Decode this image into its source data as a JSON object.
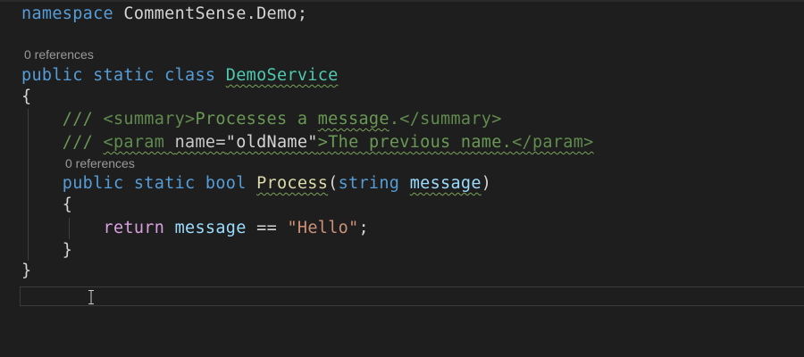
{
  "editor": {
    "lines": [
      {
        "tokens": [
          {
            "t": "namespace",
            "c": "kw"
          },
          {
            "t": " CommentSense.Demo;",
            "c": "plain"
          }
        ]
      },
      {
        "tokens": []
      },
      {
        "tokens": [
          {
            "t": "public static class ",
            "c": "kw"
          },
          {
            "t": "DemoService",
            "c": "cls",
            "sq": true
          }
        ]
      },
      {
        "tokens": [
          {
            "t": "{",
            "c": "plain"
          }
        ]
      },
      {
        "tokens": [
          {
            "t": "    /// ",
            "c": "cm"
          },
          {
            "t": "<summary>",
            "c": "tag"
          },
          {
            "t": "Processes a ",
            "c": "cm"
          },
          {
            "t": "message",
            "c": "cm",
            "sq": true
          },
          {
            "t": ".",
            "c": "cm"
          },
          {
            "t": "</summary>",
            "c": "tag"
          }
        ]
      },
      {
        "tokens": [
          {
            "t": "    /// ",
            "c": "cm"
          },
          {
            "t": "<param ",
            "c": "tag",
            "sq": true
          },
          {
            "t": "name=",
            "c": "attr",
            "sq": true
          },
          {
            "t": "\"oldName\"",
            "c": "plain",
            "sq": true
          },
          {
            "t": ">The previous name.",
            "c": "cm",
            "sq": true
          },
          {
            "t": "</param>",
            "c": "tag",
            "sq": true
          }
        ]
      },
      {
        "tokens": [
          {
            "t": "    public static bool ",
            "c": "kw"
          },
          {
            "t": "Process",
            "c": "fn",
            "sq": true
          },
          {
            "t": "(",
            "c": "plain"
          },
          {
            "t": "string ",
            "c": "kw"
          },
          {
            "t": "message",
            "c": "par",
            "sq": true
          },
          {
            "t": ")",
            "c": "plain"
          }
        ]
      },
      {
        "tokens": [
          {
            "t": "    {",
            "c": "plain"
          }
        ]
      },
      {
        "tokens": [
          {
            "t": "        ",
            "c": "plain"
          },
          {
            "t": "return",
            "c": "ctl"
          },
          {
            "t": " ",
            "c": "plain"
          },
          {
            "t": "message",
            "c": "par"
          },
          {
            "t": " == ",
            "c": "plain"
          },
          {
            "t": "\"Hello\"",
            "c": "str"
          },
          {
            "t": ";",
            "c": "plain"
          }
        ]
      },
      {
        "tokens": [
          {
            "t": "    }",
            "c": "plain"
          }
        ]
      },
      {
        "tokens": [
          {
            "t": "}",
            "c": "plain"
          }
        ]
      }
    ],
    "codelens": [
      "0 references",
      "0 references"
    ],
    "colors": {
      "background": "#1e1e1e",
      "keyword": "#569cd6",
      "class": "#4ec9b0",
      "comment": "#6a9955",
      "method": "#dcdcaa",
      "parameter": "#9cdcfe",
      "string": "#ce9178"
    }
  }
}
